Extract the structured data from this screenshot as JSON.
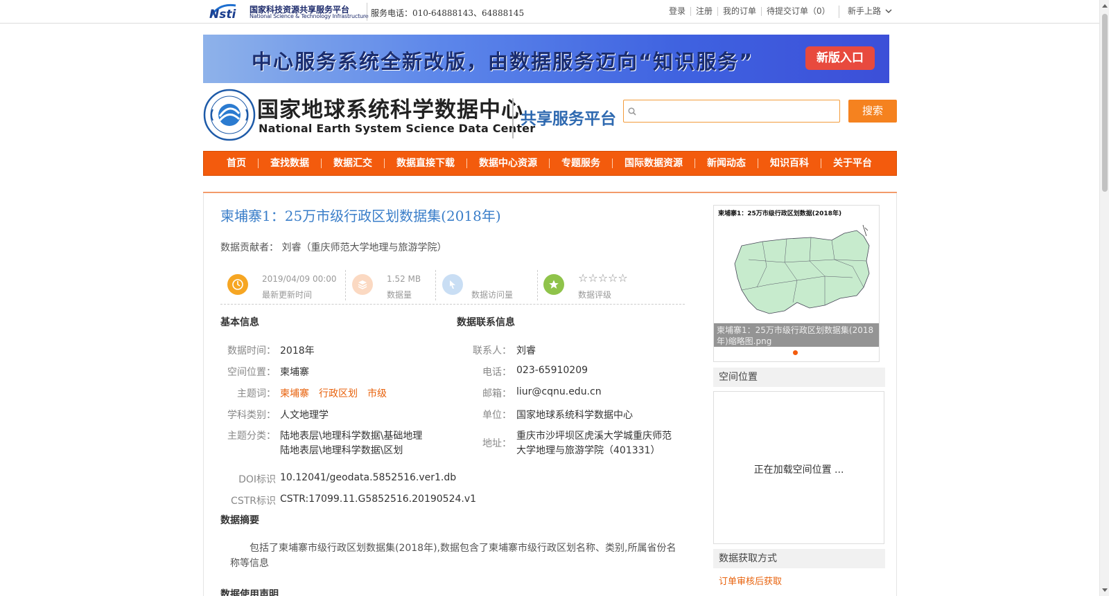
{
  "topbar": {
    "logo_cn": "国家科技资源共享服务平台",
    "logo_en": "National Science & Technology Infrastructure",
    "phone": "服务电话：010-64888143、64888145",
    "links": [
      "登录",
      "注册",
      "我的订单",
      "待提交订单（0）"
    ],
    "guide": "新手上路"
  },
  "banner": {
    "text": "中心服务系统全新改版，由数据服务迈向“知识服务”",
    "button": "新版入口"
  },
  "header": {
    "title_cn": "国家地球系统科学数据中心",
    "title_en": "National Earth System Science Data Center",
    "platform": "共享服务平台",
    "search_placeholder": "",
    "search_button": "搜索"
  },
  "nav": [
    "首页",
    "查找数据",
    "数据汇交",
    "数据直接下载",
    "数据中心资源",
    "专题服务",
    "国际数据资源",
    "新闻动态",
    "知识百科",
    "关于平台"
  ],
  "dataset": {
    "title": "柬埔寨1：25万市级行政区划数据集(2018年)",
    "contributor_label": "数据贡献者：",
    "contributor": "刘睿（重庆师范大学地理与旅游学院）",
    "stats": {
      "updated_value": "2019/04/09 00:00",
      "updated_label": "最新更新时间",
      "size_value": "1.52 MB",
      "size_label": "数据量",
      "visits_value": "",
      "visits_label": "数据访问量",
      "rating_stars": "☆☆☆☆☆",
      "rating_label": "数据评级"
    }
  },
  "basic": {
    "heading": "基本信息",
    "time_label": "数据时间：",
    "time_value": "2018年",
    "space_label": "空间位置：",
    "space_value": "柬埔寨",
    "keywords_label": "主题词：",
    "keywords": [
      "柬埔寨",
      "行政区划",
      "市级"
    ],
    "discipline_label": "学科类别：",
    "discipline_value": "人文地理学",
    "category_label": "主题分类：",
    "categories": [
      "陆地表层\\地理科学数据\\基础地理",
      "陆地表层\\地理科学数据\\区划"
    ],
    "doi_label": "DOI标识",
    "doi_value": "10.12041/geodata.5852516.ver1.db",
    "cstr_label": "CSTR标识",
    "cstr_value": "CSTR:17099.11.G5852516.20190524.v1"
  },
  "contact": {
    "heading": "数据联系信息",
    "person_label": "联系人：",
    "person_value": "刘睿",
    "phone_label": "电话：",
    "phone_value": "023-65910209",
    "email_label": "邮箱：",
    "email_value": "liur@cqnu.edu.cn",
    "unit_label": "单位：",
    "unit_value": "国家地球系统科学数据中心",
    "address_label": "地址：",
    "address_line1": "重庆市沙坪坝区虎溪大学城重庆师范",
    "address_line2": "大学地理与旅游学院（401331）"
  },
  "abstract": {
    "heading": "数据摘要",
    "text": "包括了柬埔寨市级行政区划数据集(2018年),数据包含了柬埔寨市级行政区划名称、类别,所属省份名称等信息"
  },
  "usage": {
    "heading": "数据使用声明"
  },
  "sidebar": {
    "thumb_title": "柬埔寨1：25万市级行政区划数据(2018年)",
    "thumb_caption": "柬埔寨1：25万市级行政区划数据集(2018年)缩略图.png",
    "spatial_heading": "空间位置",
    "spatial_loading": "正在加载空间位置 ...",
    "access_heading": "数据获取方式",
    "access_link": "订单审核后获取"
  },
  "colors": {
    "accent": "#f35b0d",
    "title_blue": "#3a7ec9",
    "link_orange": "#e8620c"
  },
  "icons": [
    "search-icon",
    "chevron-down-icon",
    "clock-icon",
    "layers-icon",
    "pointer-icon",
    "star-icon",
    "seal-logo-icon",
    "nsti-logo-icon"
  ]
}
